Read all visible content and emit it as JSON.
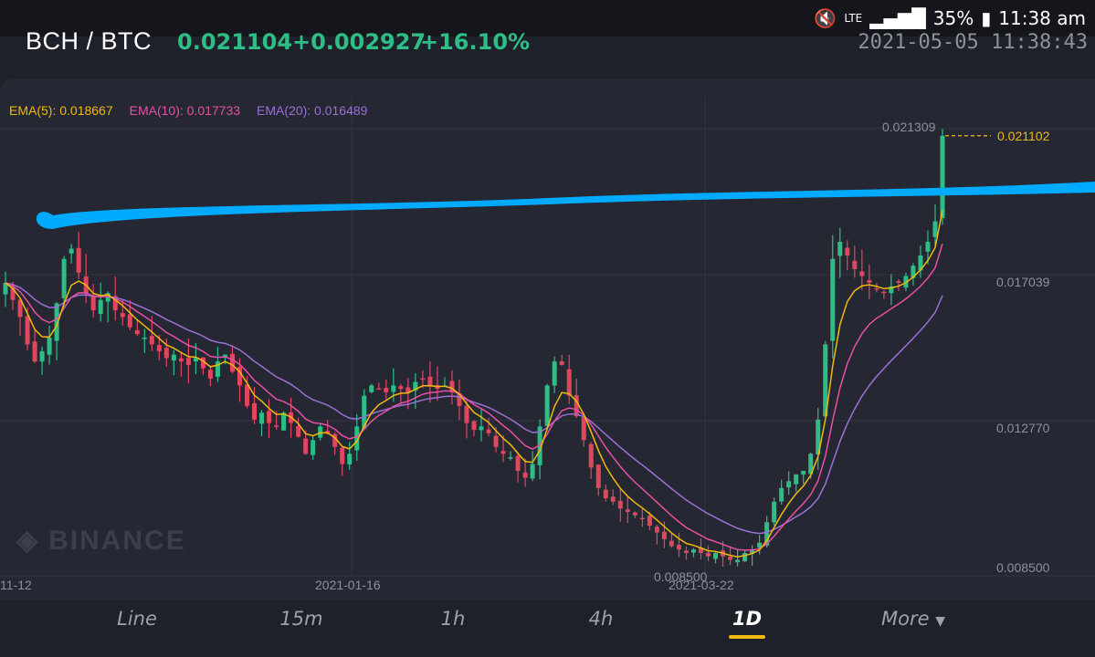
{
  "status": {
    "mute_icon": "mute-icon",
    "network": "LTE",
    "battery": "35%",
    "time": "11:38 am"
  },
  "header": {
    "pair": "BCH / BTC",
    "price": "0.021104",
    "change": "+0.002927",
    "change_pct": "+16.10%",
    "datetime": "2021-05-05 11:38:43"
  },
  "ema_legend": {
    "ema5": "EMA(5): 0.018667",
    "ema10": "EMA(10): 0.017733",
    "ema20": "EMA(20): 0.016489"
  },
  "watermark": "BINANCE",
  "tabs": [
    {
      "label": "Line",
      "active": false
    },
    {
      "label": "15m",
      "active": false
    },
    {
      "label": "1h",
      "active": false
    },
    {
      "label": "4h",
      "active": false
    },
    {
      "label": "1D",
      "active": true
    },
    {
      "label": "More",
      "active": false
    }
  ],
  "chart_data": {
    "type": "candlestick",
    "title": "",
    "x_tick_labels": [
      "11-12",
      "2021-01-16",
      "2021-03-22"
    ],
    "y_tick_labels": [
      "0.017039",
      "0.012770",
      "0.008500"
    ],
    "ylim": [
      0.0085,
      0.021309
    ],
    "high_label": "0.021309",
    "low_label": "0.008500",
    "current_price_label": "0.021102",
    "current_price": 0.021102,
    "colors": {
      "up": "#2ebd85",
      "down": "#e0475e",
      "ema5": "#f0b90b",
      "ema10": "#e84fa6",
      "ema20": "#9b6fd6",
      "annotation": "#00aaff"
    },
    "ema_series": [
      {
        "name": "EMA(5)",
        "last": 0.018667
      },
      {
        "name": "EMA(10)",
        "last": 0.017733
      },
      {
        "name": "EMA(20)",
        "last": 0.016489
      }
    ],
    "close_approx": [
      0.0168,
      0.0163,
      0.0158,
      0.015,
      0.0145,
      0.0148,
      0.0152,
      0.0162,
      0.0175,
      0.0178,
      0.0171,
      0.0165,
      0.016,
      0.0163,
      0.0165,
      0.016,
      0.0158,
      0.0155,
      0.0153,
      0.0152,
      0.015,
      0.0148,
      0.0146,
      0.0147,
      0.0145,
      0.0144,
      0.0146,
      0.0143,
      0.014,
      0.0145,
      0.0147,
      0.0142,
      0.0138,
      0.0132,
      0.0128,
      0.013,
      0.0127,
      0.0126,
      0.013,
      0.0127,
      0.0123,
      0.0118,
      0.0122,
      0.0126,
      0.0124,
      0.012,
      0.0115,
      0.0118,
      0.0126,
      0.0135,
      0.0138,
      0.0137,
      0.0136,
      0.0138,
      0.0137,
      0.0136,
      0.0139,
      0.014,
      0.0138,
      0.0137,
      0.0138,
      0.0136,
      0.0132,
      0.0127,
      0.0125,
      0.0126,
      0.0124,
      0.012,
      0.0118,
      0.0117,
      0.0113,
      0.0111,
      0.0115,
      0.0126,
      0.0138,
      0.0145,
      0.0144,
      0.0135,
      0.0129,
      0.0122,
      0.0114,
      0.0108,
      0.0105,
      0.0104,
      0.0102,
      0.0101,
      0.01,
      0.0099,
      0.0097,
      0.0095,
      0.0093,
      0.0091,
      0.009,
      0.0089,
      0.009,
      0.0089,
      0.0088,
      0.0089,
      0.0088,
      0.0087,
      0.0087,
      0.0089,
      0.009,
      0.0092,
      0.0098,
      0.0104,
      0.0108,
      0.011,
      0.0112,
      0.0113,
      0.0118,
      0.0128,
      0.015,
      0.0175,
      0.018,
      0.0176,
      0.0172,
      0.017,
      0.0168,
      0.0166,
      0.0165,
      0.0167,
      0.0168,
      0.017,
      0.0173,
      0.0176,
      0.018,
      0.0186,
      0.0211
    ]
  }
}
